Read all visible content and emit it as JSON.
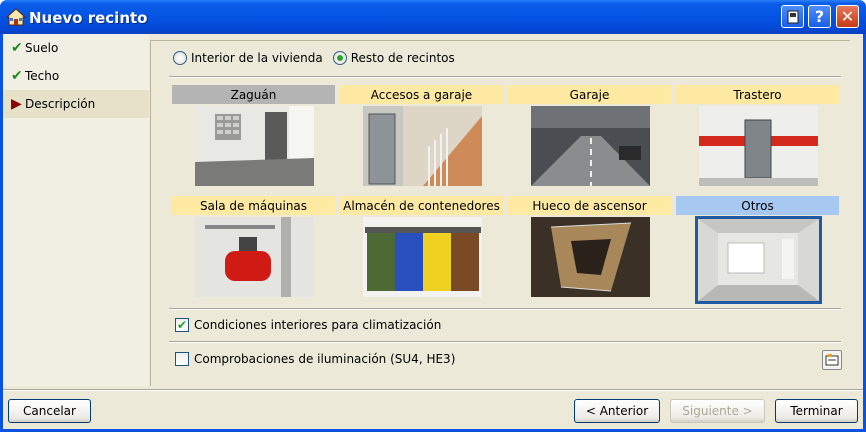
{
  "window": {
    "title": "Nuevo recinto"
  },
  "sidebar": {
    "items": [
      {
        "label": "Suelo",
        "state": "done"
      },
      {
        "label": "Techo",
        "state": "done"
      },
      {
        "label": "Descripción",
        "state": "current"
      }
    ]
  },
  "scope": {
    "options": [
      {
        "label": "Interior de la vivienda",
        "selected": false
      },
      {
        "label": "Resto de recintos",
        "selected": true
      }
    ]
  },
  "categories": [
    {
      "label": "Zaguán",
      "style": "grey"
    },
    {
      "label": "Accesos a garaje",
      "style": "yellow"
    },
    {
      "label": "Garaje",
      "style": "yellow"
    },
    {
      "label": "Trastero",
      "style": "yellow"
    },
    {
      "label": "Sala de máquinas",
      "style": "yellow"
    },
    {
      "label": "Almacén de contenedores",
      "style": "yellow"
    },
    {
      "label": "Hueco de ascensor",
      "style": "yellow"
    },
    {
      "label": "Otros",
      "style": "blue",
      "selected": true
    }
  ],
  "options": {
    "climatizacion": {
      "label": "Condiciones interiores para climatización",
      "checked": true
    },
    "iluminacion": {
      "label": "Comprobaciones de iluminación (SU4, HE3)",
      "checked": false
    }
  },
  "buttons": {
    "cancel": "Cancelar",
    "back": "< Anterior",
    "next": "Siguiente >",
    "finish": "Terminar"
  }
}
